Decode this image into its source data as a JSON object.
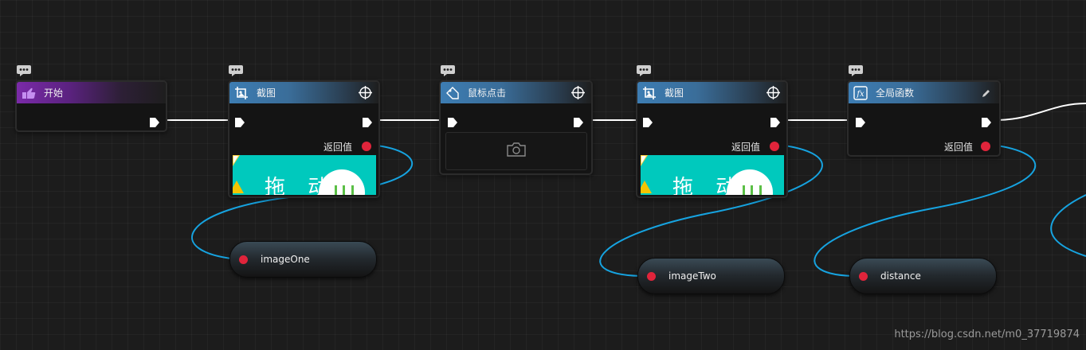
{
  "nodes": {
    "start": {
      "title": "开始"
    },
    "screenshot1": {
      "title": "截图",
      "output_label": "返回值"
    },
    "mouse_click": {
      "title": "鼠标点击"
    },
    "screenshot2": {
      "title": "截图",
      "output_label": "返回值"
    },
    "global_function": {
      "title": "全局函数",
      "output_label": "返回值"
    }
  },
  "variables": {
    "image_one": "imageOne",
    "image_two": "imageTwo",
    "distance": "distance"
  },
  "preview_text": "拖 动",
  "watermark": "https://blog.csdn.net/m0_37719874",
  "colors": {
    "canvas": "#1c1c1c",
    "node_header_blue": "#3d7db3",
    "node_header_purple": "#7a2aa8",
    "exec_wire": "#ffffff",
    "data_wire": "#16a3e0",
    "data_pin": "#e0243b",
    "preview_bg": "#00c9bd"
  },
  "icons": {
    "comment": "comment-bubble-icon",
    "start": "pointing-hand-icon",
    "screenshot": "screenshot-crop-icon",
    "mouse_click": "mouse-tag-icon",
    "global_function": "fx-function-icon",
    "target": "crosshair-icon",
    "edit": "pencil-icon",
    "camera": "camera-icon"
  }
}
